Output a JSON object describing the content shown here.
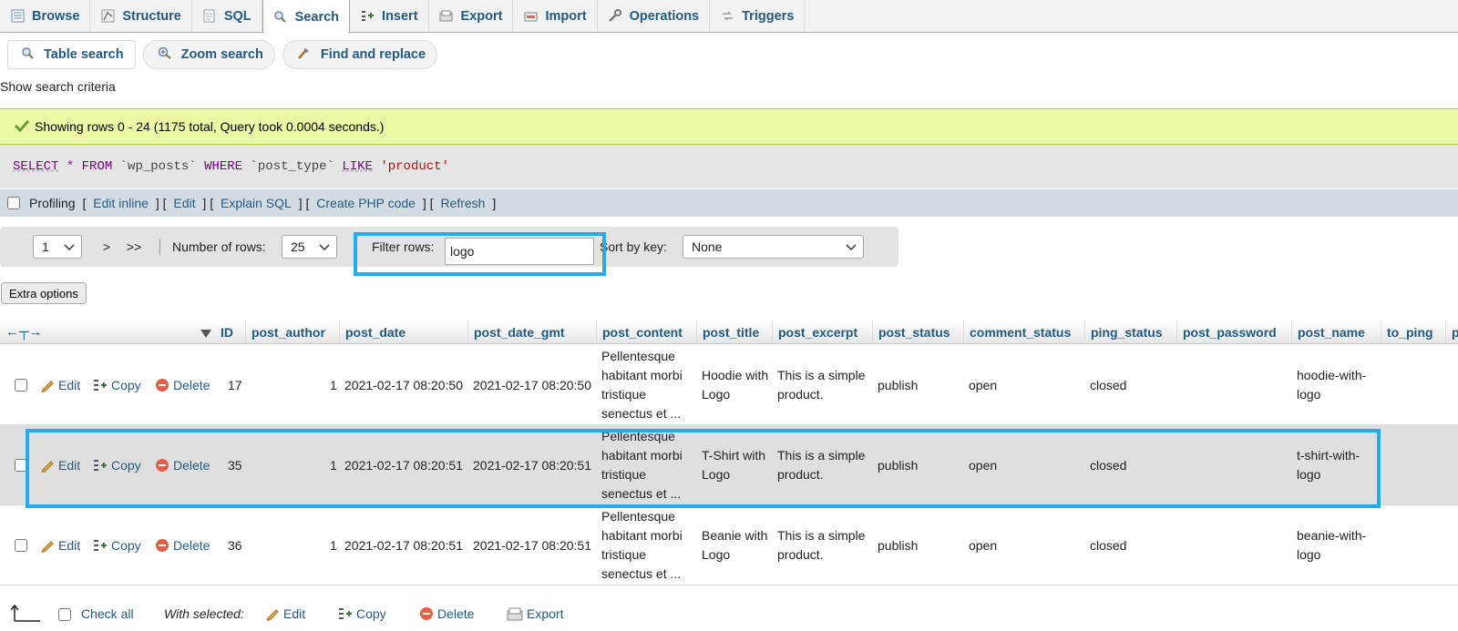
{
  "tabs": [
    {
      "label": "Browse",
      "icon": "browse-icon"
    },
    {
      "label": "Structure",
      "icon": "structure-icon"
    },
    {
      "label": "SQL",
      "icon": "sql-icon"
    },
    {
      "label": "Search",
      "icon": "search-icon",
      "active": true
    },
    {
      "label": "Insert",
      "icon": "insert-icon"
    },
    {
      "label": "Export",
      "icon": "export-icon"
    },
    {
      "label": "Import",
      "icon": "import-icon"
    },
    {
      "label": "Operations",
      "icon": "wrench-icon"
    },
    {
      "label": "Triggers",
      "icon": "triggers-icon"
    }
  ],
  "subtabs": [
    {
      "label": "Table search",
      "icon": "search-icon"
    },
    {
      "label": "Zoom search",
      "icon": "zoom-search-icon"
    },
    {
      "label": "Find and replace",
      "icon": "find-replace-icon"
    }
  ],
  "show_criteria": "Show search criteria",
  "message": {
    "text": "Showing rows 0 - 24 (1175 total, Query took 0.0004 seconds.)",
    "icon": "checkmark-icon"
  },
  "sql": {
    "select": "SELECT",
    "star": "*",
    "from": "FROM",
    "table": "`wp_posts`",
    "where": "WHERE",
    "column": "`post_type`",
    "like": "LIKE",
    "value": "'product'"
  },
  "profiling": {
    "label": "Profiling",
    "links": [
      "Edit inline",
      "Edit",
      "Explain SQL",
      "Create PHP code",
      "Refresh"
    ]
  },
  "nav": {
    "page": "1",
    "next": ">",
    "last": ">>",
    "rows_label": "Number of rows:",
    "rows_value": "25",
    "filter_label": "Filter rows:",
    "filter_value": "logo",
    "sort_label": "Sort by key:",
    "sort_value": "None"
  },
  "extra_options": "Extra options",
  "columns": [
    "ID",
    "post_author",
    "post_date",
    "post_date_gmt",
    "post_content",
    "post_title",
    "post_excerpt",
    "post_status",
    "comment_status",
    "ping_status",
    "post_password",
    "post_name",
    "to_ping",
    "pi"
  ],
  "actions": {
    "edit": "Edit",
    "copy": "Copy",
    "delete": "Delete"
  },
  "rows": [
    {
      "id": "17",
      "author": "1",
      "date": "2021-02-17 08:20:50",
      "date_gmt": "2021-02-17 08:20:50",
      "content": "Pellentesque habitant morbi tristique senectus et ...",
      "title": "Hoodie with Logo",
      "excerpt": "This is a simple product.",
      "status": "publish",
      "comment_status": "open",
      "ping_status": "closed",
      "password": "",
      "name": "hoodie-with-logo",
      "to_ping": ""
    },
    {
      "id": "35",
      "author": "1",
      "date": "2021-02-17 08:20:51",
      "date_gmt": "2021-02-17 08:20:51",
      "content": "Pellentesque habitant morbi tristique senectus et ...",
      "title": "T-Shirt with Logo",
      "excerpt": "This is a simple product.",
      "status": "publish",
      "comment_status": "open",
      "ping_status": "closed",
      "password": "",
      "name": "t-shirt-with-logo",
      "to_ping": ""
    },
    {
      "id": "36",
      "author": "1",
      "date": "2021-02-17 08:20:51",
      "date_gmt": "2021-02-17 08:20:51",
      "content": "Pellentesque habitant morbi tristique senectus et ...",
      "title": "Beanie with Logo",
      "excerpt": "This is a simple product.",
      "status": "publish",
      "comment_status": "open",
      "ping_status": "closed",
      "password": "",
      "name": "beanie-with-logo",
      "to_ping": ""
    }
  ],
  "footer": {
    "check_all": "Check all",
    "with_selected": "With selected:",
    "edit": "Edit",
    "copy": "Copy",
    "delete": "Delete",
    "export": "Export"
  },
  "colors": {
    "link": "#235a81",
    "highlight": "#29a9e8",
    "success_bg": "#ebf8a4"
  }
}
